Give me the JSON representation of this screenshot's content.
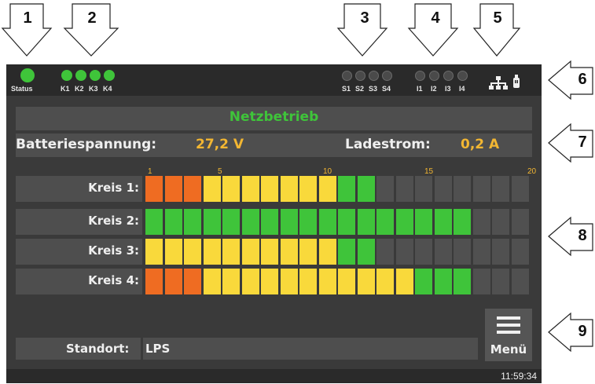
{
  "callouts": [
    "1",
    "2",
    "3",
    "4",
    "5",
    "6",
    "7",
    "8",
    "9"
  ],
  "status_bar": {
    "status_label": "Status",
    "kreis_leds": [
      {
        "label": "K1",
        "state": "on"
      },
      {
        "label": "K2",
        "state": "on"
      },
      {
        "label": "K3",
        "state": "on"
      },
      {
        "label": "K4",
        "state": "on"
      }
    ],
    "s_leds": [
      {
        "label": "S1",
        "state": "off"
      },
      {
        "label": "S2",
        "state": "off"
      },
      {
        "label": "S3",
        "state": "off"
      },
      {
        "label": "S4",
        "state": "off"
      }
    ],
    "i_leds": [
      {
        "label": "I1",
        "state": "off"
      },
      {
        "label": "I2",
        "state": "off"
      },
      {
        "label": "I3",
        "state": "off"
      },
      {
        "label": "I4",
        "state": "off"
      }
    ],
    "icons": [
      "network-icon",
      "usb-icon"
    ]
  },
  "mode": "Netzbetrieb",
  "measurements": {
    "battery_label": "Batteriespannung:",
    "battery_value": "27,2 V",
    "charge_label": "Ladestrom:",
    "charge_value": "0,2 A"
  },
  "scale_labels": [
    "1",
    "5",
    "10",
    "15",
    "20"
  ],
  "colors": {
    "orange": "#ef6c22",
    "yellow": "#f9d93b",
    "green": "#3fc43a",
    "empty": "#505050",
    "accent_value": "#f2b632"
  },
  "kreise": [
    {
      "label": "Kreis 1:",
      "segments": [
        "o",
        "o",
        "o",
        "y",
        "y",
        "y",
        "y",
        "y",
        "y",
        "y",
        "g",
        "g",
        "e",
        "e",
        "e",
        "e",
        "e",
        "e",
        "e",
        "e"
      ]
    },
    {
      "label": "Kreis 2:",
      "segments": [
        "g",
        "g",
        "g",
        "g",
        "g",
        "g",
        "g",
        "g",
        "g",
        "g",
        "g",
        "g",
        "g",
        "g",
        "g",
        "g",
        "g",
        "e",
        "e",
        "e"
      ]
    },
    {
      "label": "Kreis 3:",
      "segments": [
        "y",
        "y",
        "y",
        "y",
        "y",
        "y",
        "y",
        "y",
        "y",
        "y",
        "g",
        "g",
        "e",
        "e",
        "e",
        "e",
        "e",
        "e",
        "e",
        "e"
      ]
    },
    {
      "label": "Kreis 4:",
      "segments": [
        "o",
        "o",
        "o",
        "y",
        "y",
        "y",
        "y",
        "y",
        "y",
        "y",
        "y",
        "y",
        "y",
        "y",
        "g",
        "g",
        "g",
        "e",
        "e",
        "e"
      ]
    }
  ],
  "standort": {
    "label": "Standort:",
    "value": "LPS"
  },
  "menu": {
    "label": "Menü"
  },
  "clock": "11:59:34"
}
